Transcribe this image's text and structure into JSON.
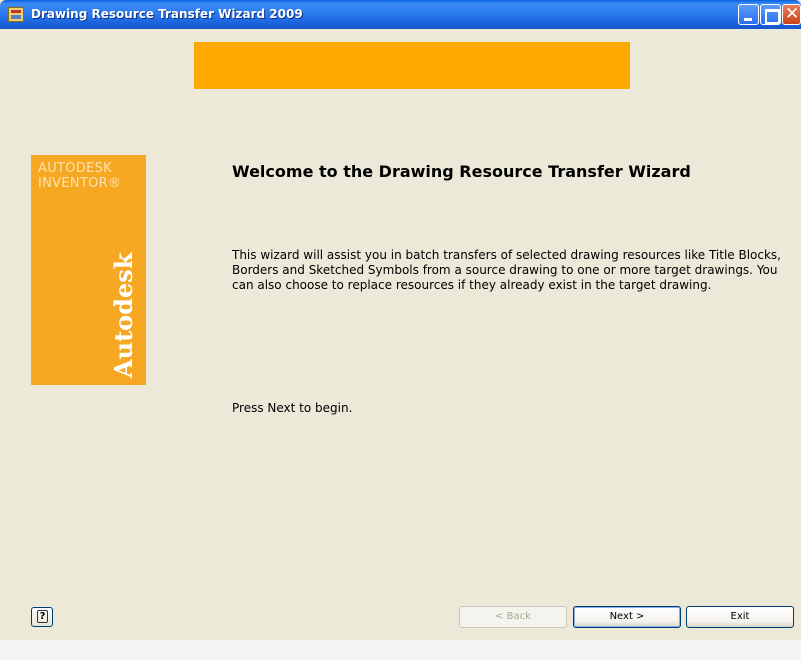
{
  "window": {
    "title": "Drawing Resource Transfer Wizard 2009",
    "accent": "#ffa800",
    "titlebar_color": "#2a78ee"
  },
  "side_panel": {
    "brand_line1": "AUTODESK",
    "brand_line2": "INVENTOR®",
    "logo": "Autodesk"
  },
  "main": {
    "heading": "Welcome to the Drawing Resource Transfer Wizard",
    "description": "This wizard will assist you in batch transfers of selected drawing resources like Title Blocks, Borders and Sketched Symbols from a source drawing to one or more target drawings. You can also choose to replace resources if they already exist in the target drawing.",
    "instruction": "Press Next to begin."
  },
  "footer": {
    "help_icon": "?",
    "back_label": "< Back",
    "next_label": "Next >",
    "exit_label": "Exit"
  }
}
